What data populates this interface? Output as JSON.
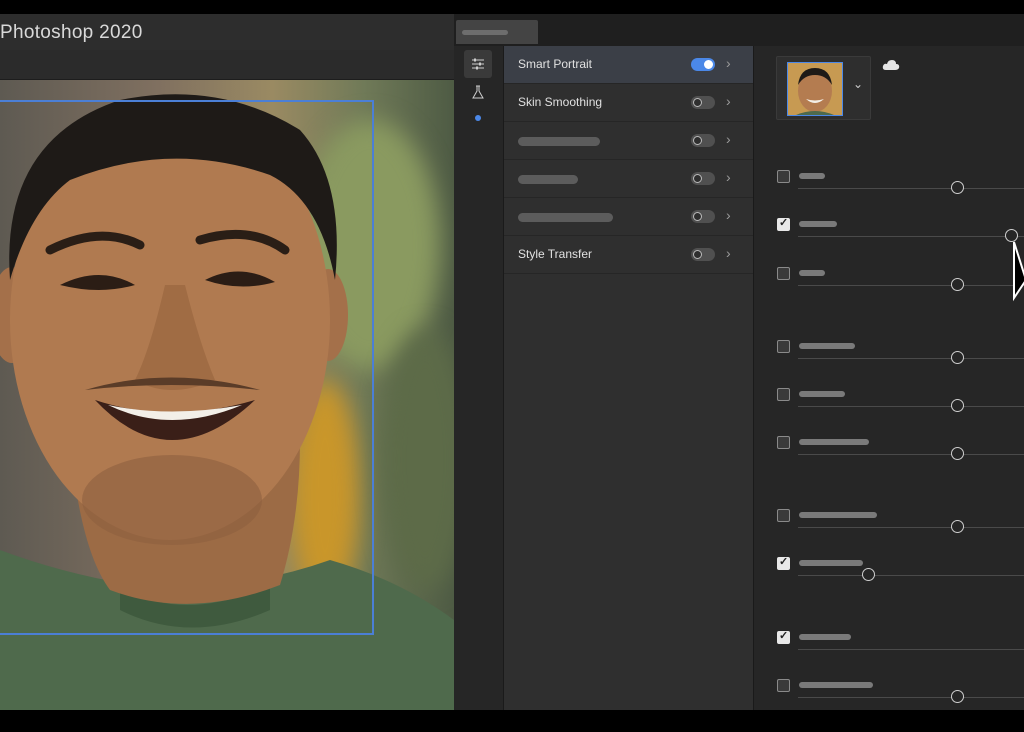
{
  "app": {
    "title": "Photoshop 2020"
  },
  "icons": {
    "rail": [
      "sliders-icon",
      "flask-icon",
      "dot-indicator-icon"
    ],
    "settings": [
      "cloud-icon",
      "chevron-down-icon"
    ],
    "cursor": "mouse-pointer-icon"
  },
  "filters": {
    "items": [
      {
        "label": "Smart Portrait",
        "enabled": true,
        "active": true
      },
      {
        "label": "Skin Smoothing",
        "enabled": false,
        "active": false
      },
      {
        "label": "",
        "enabled": false,
        "active": false
      },
      {
        "label": "",
        "enabled": false,
        "active": false
      },
      {
        "label": "",
        "enabled": false,
        "active": false
      },
      {
        "label": "Style Transfer",
        "enabled": false,
        "active": false
      }
    ]
  },
  "settings": {
    "sliders": [
      {
        "checked": false,
        "value": 0.7
      },
      {
        "checked": true,
        "value": 0.94
      },
      {
        "checked": false,
        "value": 0.7
      },
      {
        "checked": false,
        "value": 0.7
      },
      {
        "checked": false,
        "value": 0.7
      },
      {
        "checked": false,
        "value": 0.7
      },
      {
        "checked": false,
        "value": 0.7
      },
      {
        "checked": true,
        "value": 0.31
      },
      {
        "checked": true,
        "value": null
      },
      {
        "checked": false,
        "value": 0.7
      }
    ]
  },
  "colors": {
    "accent": "#4b88e8",
    "panel": "#2f2f2f",
    "rail": "#262626"
  }
}
